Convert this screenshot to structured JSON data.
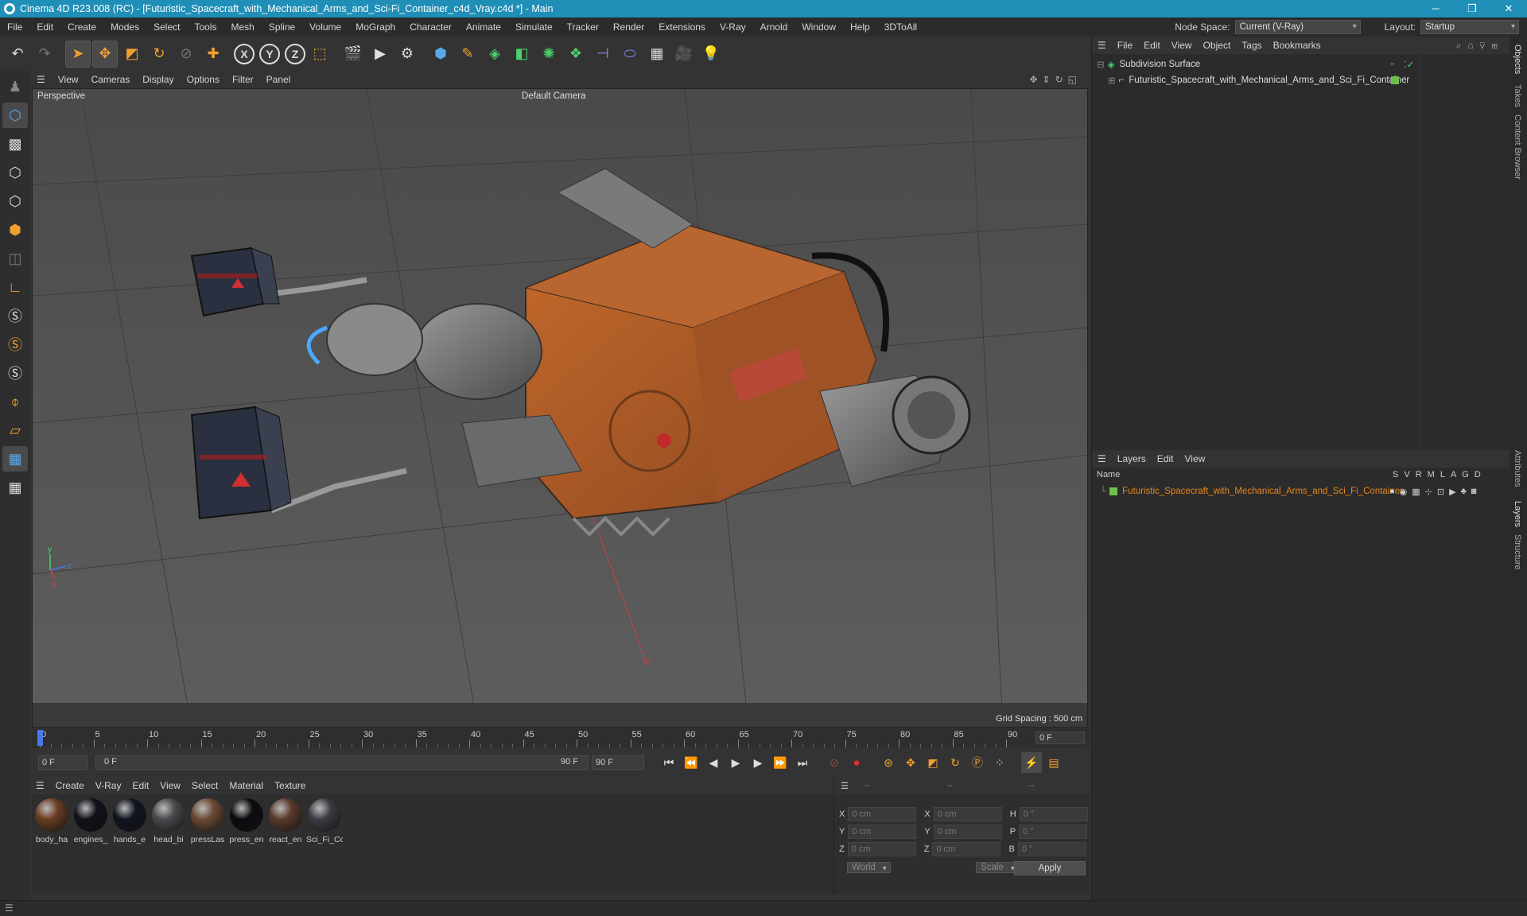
{
  "window": {
    "title": "Cinema 4D R23.008 (RC) - [Futuristic_Spacecraft_with_Mechanical_Arms_and_Sci-Fi_Container_c4d_Vray.c4d *] - Main",
    "accent": "#1f8fb8"
  },
  "menubar": {
    "items": [
      "File",
      "Edit",
      "Create",
      "Modes",
      "Select",
      "Tools",
      "Mesh",
      "Spline",
      "Volume",
      "MoGraph",
      "Character",
      "Animate",
      "Simulate",
      "Tracker",
      "Render",
      "Extensions",
      "V-Ray",
      "Arnold",
      "Window",
      "Help",
      "3DToAll"
    ],
    "node_space_label": "Node Space:",
    "node_space_value": "Current (V-Ray)",
    "layout_label": "Layout:",
    "layout_value": "Startup"
  },
  "viewport": {
    "menu": [
      "View",
      "Cameras",
      "Display",
      "Options",
      "Filter",
      "Panel"
    ],
    "label": "Perspective",
    "camera": "Default Camera",
    "grid_spacing": "Grid Spacing : 500 cm"
  },
  "timeline": {
    "ticks": [
      "0",
      "5",
      "10",
      "15",
      "20",
      "25",
      "30",
      "35",
      "40",
      "45",
      "50",
      "55",
      "60",
      "65",
      "70",
      "75",
      "80",
      "85",
      "90"
    ],
    "current_frame": "0 F",
    "start_field": "0 F",
    "range_start": "0 F",
    "range_end": "90 F",
    "end_field": "90 F"
  },
  "materials": {
    "menu": [
      "Create",
      "V-Ray",
      "Edit",
      "View",
      "Select",
      "Material",
      "Texture"
    ],
    "items": [
      {
        "name": "body_ha",
        "color": "#6a3d22"
      },
      {
        "name": "engines_",
        "color": "#101018"
      },
      {
        "name": "hands_e",
        "color": "#0f1420"
      },
      {
        "name": "head_bi",
        "color": "#4a4a4e"
      },
      {
        "name": "pressLas",
        "color": "#6c4a35"
      },
      {
        "name": "press_en",
        "color": "#0c0c10"
      },
      {
        "name": "react_en",
        "color": "#5a3a2c"
      },
      {
        "name": "Sci_Fi_Cc",
        "color": "#3e3a44"
      }
    ]
  },
  "coords": {
    "header": [
      "--",
      "--",
      "--"
    ],
    "rows": [
      {
        "a": "X",
        "v1": "0 cm",
        "b": "X",
        "v2": "0 cm",
        "c": "H",
        "v3": "0 °"
      },
      {
        "a": "Y",
        "v1": "0 cm",
        "b": "Y",
        "v2": "0 cm",
        "c": "P",
        "v3": "0 °"
      },
      {
        "a": "Z",
        "v1": "0 cm",
        "b": "Z",
        "v2": "0 cm",
        "c": "B",
        "v3": "0 °"
      }
    ],
    "mode1": "World",
    "mode2": "Scale",
    "apply": "Apply"
  },
  "objects": {
    "menu": [
      "File",
      "Edit",
      "View",
      "Object",
      "Tags",
      "Bookmarks"
    ],
    "tree": [
      "Subdivision Surface",
      "Futuristic_Spacecraft_with_Mechanical_Arms_and_Sci_Fi_Container"
    ]
  },
  "layers": {
    "menu": [
      "Layers",
      "Edit",
      "View"
    ],
    "col_name": "Name",
    "cols": [
      "S",
      "V",
      "R",
      "M",
      "L",
      "A",
      "G",
      "D"
    ],
    "row": "Futuristic_Spacecraft_with_Mechanical_Arms_and_Sci_Fi_Container",
    "layer_color": "#e8861a"
  },
  "side_tabs": [
    "Objects",
    "Takes",
    "Content Browser",
    "Attributes",
    "Layers",
    "Structure"
  ]
}
